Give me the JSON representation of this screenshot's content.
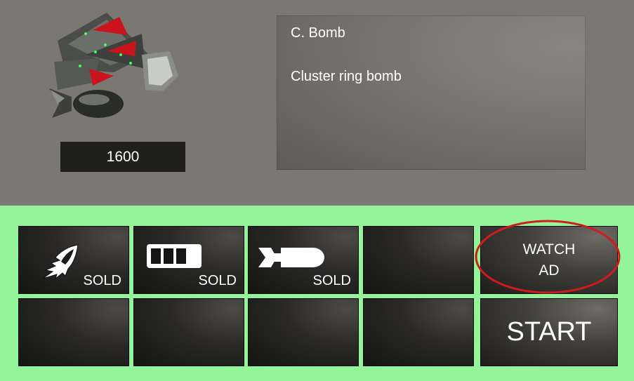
{
  "shop": {
    "item_name": "C. Bomb",
    "item_description": "Cluster ring bomb",
    "price": "1600"
  },
  "slots": [
    {
      "icon": "rocket-flame-icon",
      "status": "SOLD"
    },
    {
      "icon": "battery-icon",
      "status": "SOLD"
    },
    {
      "icon": "bomb-icon",
      "status": "SOLD"
    },
    {
      "icon": "",
      "status": ""
    },
    {
      "icon": "",
      "status": ""
    },
    {
      "icon": "",
      "status": ""
    },
    {
      "icon": "",
      "status": ""
    },
    {
      "icon": "",
      "status": ""
    }
  ],
  "buttons": {
    "watch_ad_line1": "WATCH",
    "watch_ad_line2": "AD",
    "start": "START"
  },
  "colors": {
    "top_panel": "#7b7873",
    "bottom_panel": "#94f49a",
    "highlight_ring": "#d11a1a"
  }
}
